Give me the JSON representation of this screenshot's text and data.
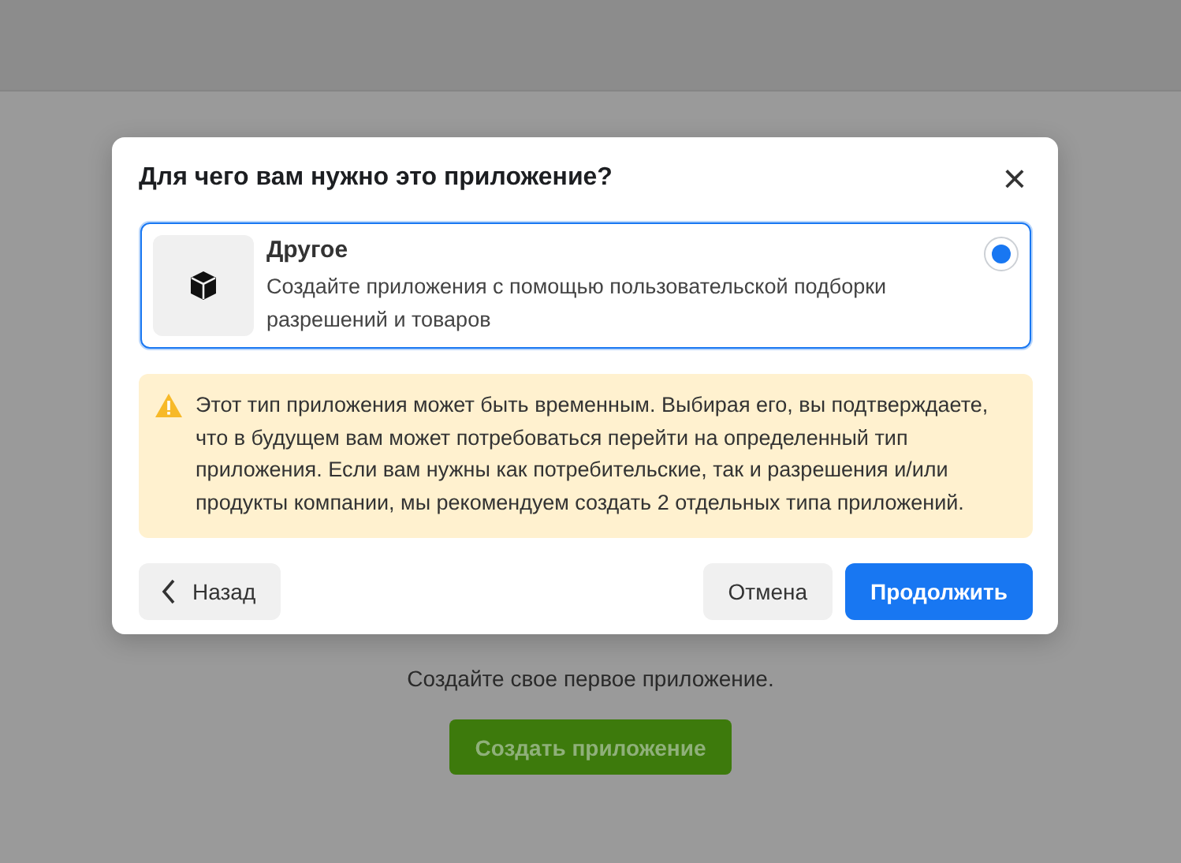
{
  "background": {
    "message": "Создайте свое первое приложение.",
    "button": "Создать приложение"
  },
  "dialog": {
    "title": "Для чего вам нужно это приложение?",
    "close": "×",
    "options": [
      {
        "title": "Другое",
        "description": "Создайте приложения с помощью пользовательской подборки разрешений и товаров",
        "selected": true
      }
    ],
    "warning": "Этот тип приложения может быть временным. Выбирая его, вы подтверждаете, что в будущем вам может потребоваться перейти на определенный тип приложения. Если вам нужны как потребительские, так и разрешения и/или продукты компании, мы рекомендуем создать 2 отдельных типа приложений.",
    "back": "Назад",
    "cancel": "Отмена",
    "continue": "Продолжить"
  }
}
